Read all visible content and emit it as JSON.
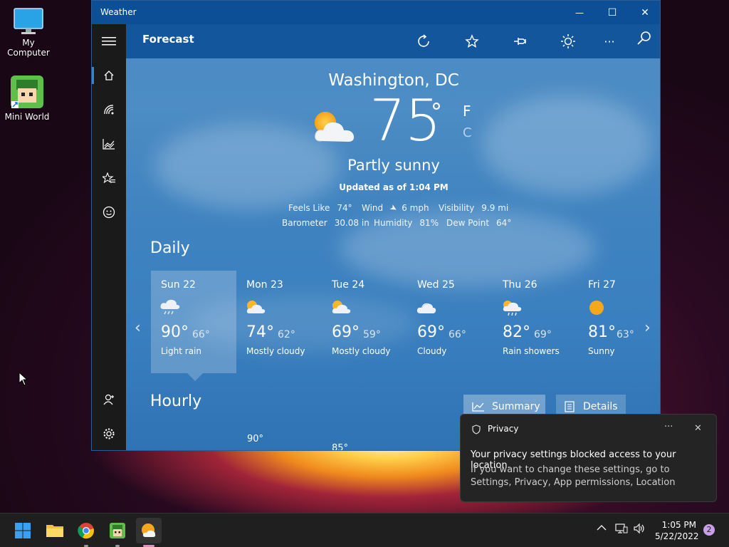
{
  "desktop": {
    "icons": [
      {
        "label": "My Computer",
        "icon": "monitor-icon"
      },
      {
        "label": "Mini World",
        "icon": "mini-world-icon"
      }
    ]
  },
  "window": {
    "title": "Weather",
    "controls": {
      "minimize": "—",
      "maximize": "☐",
      "close": "✕"
    }
  },
  "appbar": {
    "title": "Forecast",
    "actions": [
      "refresh-icon",
      "favorite-star-icon",
      "pin-icon",
      "brightness-icon",
      "more-icon",
      "search-icon"
    ],
    "more_label": "···"
  },
  "nav": {
    "items": [
      "hamburger-icon",
      "home-icon",
      "radar-icon",
      "chart-icon",
      "favorites-icon",
      "smiley-icon"
    ],
    "bottom": [
      "account-icon",
      "settings-icon"
    ]
  },
  "current": {
    "location": "Washington, DC",
    "temp": "75",
    "degree": "°",
    "unit_f": "F",
    "unit_c": "C",
    "condition": "Partly sunny",
    "updated": "Updated as of 1:04 PM",
    "feels_like_label": "Feels Like",
    "feels_like": "74°",
    "wind_label": "Wind",
    "wind": "6 mph",
    "visibility_label": "Visibility",
    "visibility": "9.9 mi",
    "barometer_label": "Barometer",
    "barometer": "30.08 in",
    "humidity_label": "Humidity",
    "humidity": "81%",
    "dewpoint_label": "Dew Point",
    "dewpoint": "64°"
  },
  "daily": {
    "heading": "Daily",
    "days": [
      {
        "name": "Sun 22",
        "hi": "90°",
        "lo": "66°",
        "cond": "Light rain",
        "icon": "rain-icon"
      },
      {
        "name": "Mon 23",
        "hi": "74°",
        "lo": "62°",
        "cond": "Mostly cloudy",
        "icon": "partly-cloudy-icon"
      },
      {
        "name": "Tue 24",
        "hi": "69°",
        "lo": "59°",
        "cond": "Mostly cloudy",
        "icon": "partly-cloudy-icon"
      },
      {
        "name": "Wed 25",
        "hi": "69°",
        "lo": "66°",
        "cond": "Cloudy",
        "icon": "cloudy-icon"
      },
      {
        "name": "Thu 26",
        "hi": "82°",
        "lo": "69°",
        "cond": "Rain showers",
        "icon": "showers-icon"
      },
      {
        "name": "Fri 27",
        "hi": "81°",
        "lo": "63°",
        "cond": "Sunny",
        "icon": "sun-icon"
      }
    ]
  },
  "hourly": {
    "heading": "Hourly",
    "summary_label": "Summary",
    "details_label": "Details",
    "peeks": [
      "90°",
      "85°"
    ]
  },
  "toast": {
    "title": "Privacy",
    "more": "···",
    "close": "✕",
    "line1": "Your privacy settings blocked access to your location.",
    "line2": "If you want to change these settings, go to Settings, Privacy, App permissions, Location"
  },
  "taskbar": {
    "apps": [
      "start-icon",
      "file-explorer-icon",
      "chrome-icon",
      "mini-world-icon",
      "weather-icon"
    ],
    "time": "1:05 PM",
    "date": "5/22/2022",
    "notification_count": "2"
  }
}
